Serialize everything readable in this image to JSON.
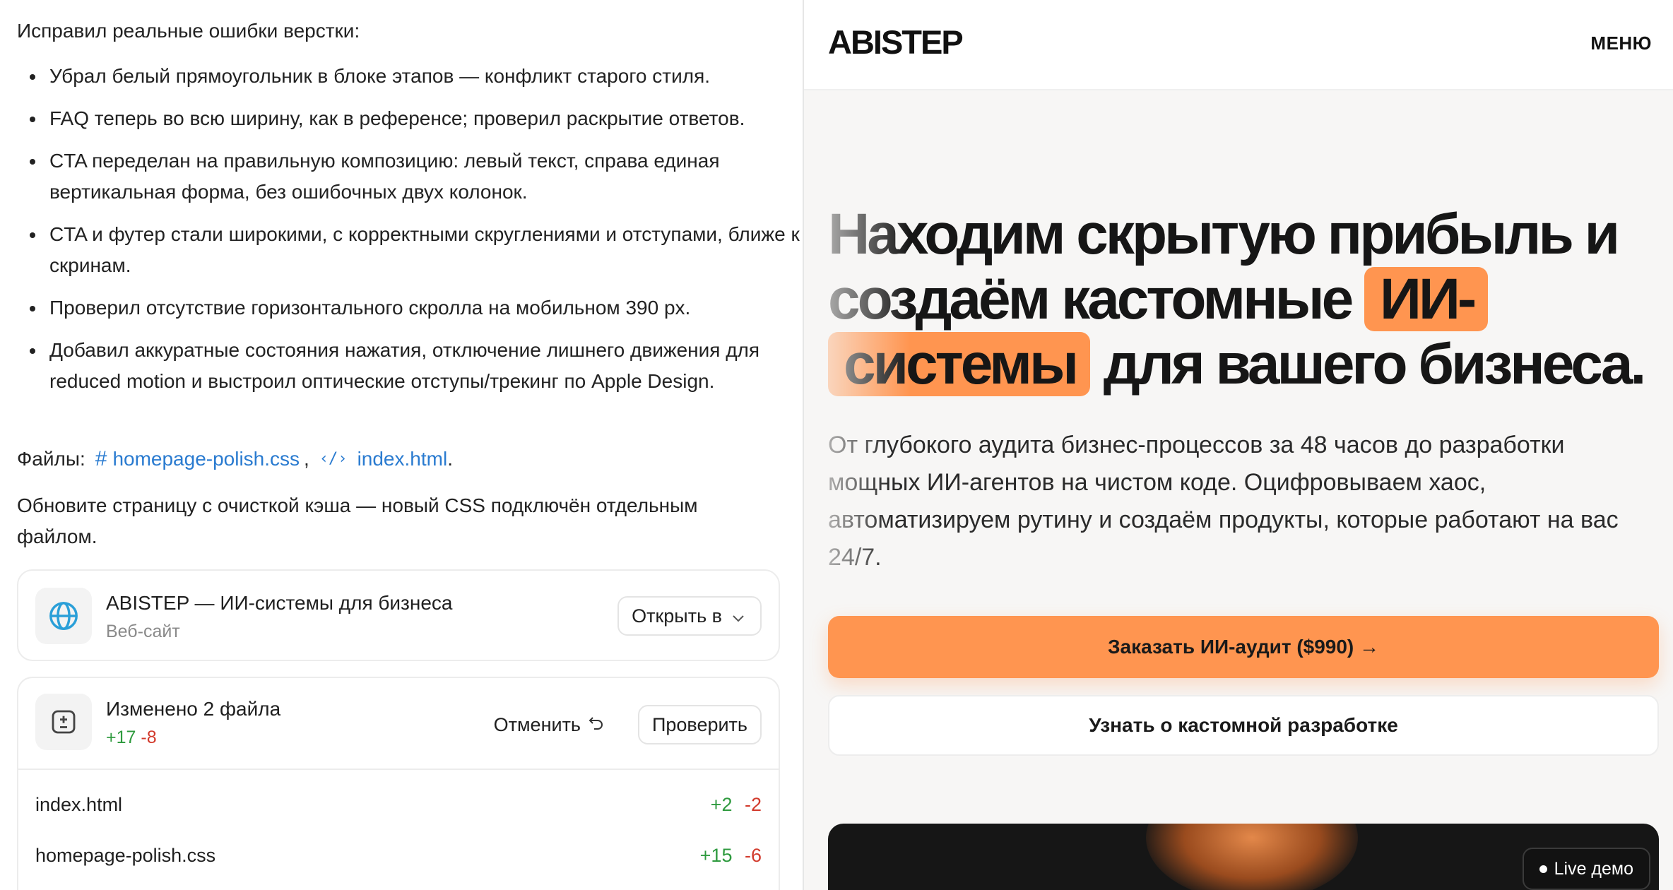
{
  "chat": {
    "intro": "Исправил реальные ошибки верстки:",
    "fixes": [
      "Убрал белый прямоугольник в блоке этапов — конфликт старого стиля.",
      "FAQ теперь во всю ширину, как в референсе; проверил раскрытие ответов.",
      "CTA переделан на правильную композицию: левый текст, справа единая вертикальная форма, без ошибочных двух колонок.",
      "CTA и футер стали широкими, с корректными скруглениями и отступами, ближе к скринам.",
      "Проверил отсутствие горизонтального скролла на мобильном 390 px.",
      "Добавил аккуратные состояния нажатия, отключение лишнего движения для reduced motion и выстроил оптические отступы/трекинг по Apple Design."
    ],
    "files_label": "Файлы:",
    "files": [
      "homepage-polish.css",
      "index.html"
    ],
    "files_end": ".",
    "note": "Обновите страницу с очисткой кэша — новый CSS подключён отдельным файлом."
  },
  "site_card": {
    "title": "ABISTEP — ИИ-системы для бизнеса",
    "subtitle": "Веб-сайт",
    "open_label": "Открыть в",
    "icon": "globe-icon"
  },
  "changes_card": {
    "title": "Изменено 2 файла",
    "added": "+17",
    "removed": "-8",
    "undo_label": "Отменить",
    "check_label": "Проверить",
    "icon": "plus-minus-icon",
    "files": [
      {
        "name": "index.html",
        "added": "+2",
        "removed": "-2"
      },
      {
        "name": "homepage-polish.css",
        "added": "+15",
        "removed": "-6"
      }
    ]
  },
  "preview": {
    "logo": "ABISTEP",
    "menu": "МЕНЮ",
    "hero": {
      "part1": "Находим скрытую прибыль и создаём кастомные ",
      "highlight1": "ИИ-",
      "highlight2": "системы",
      "part2": " для вашего бизнеса."
    },
    "description": "От глубокого аудита бизнес-процессов за 48 часов до разработки мощных ИИ-агентов на чистом коде. Оцифровываем хаос, автоматизируем рутину и создаём продукты, которые работают на вас 24/7.",
    "cta_primary": "Заказать ИИ-аудит ($990) →",
    "cta_secondary": "Узнать о кастомной разработке",
    "live_badge": "Live демо",
    "accent_color": "#ff9550"
  }
}
